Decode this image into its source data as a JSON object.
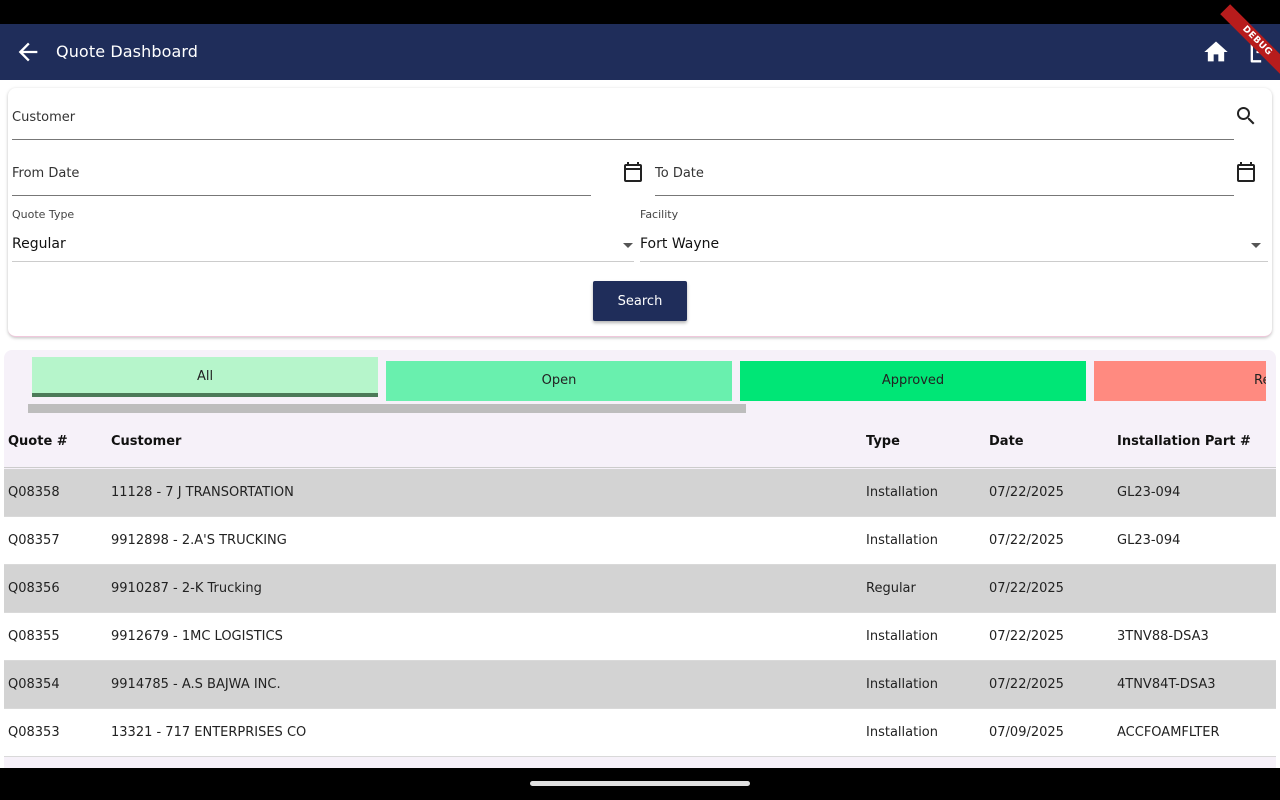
{
  "appbar": {
    "title": "Quote Dashboard",
    "debug_label": "DEBUG",
    "color": "#1f2d5a"
  },
  "filters": {
    "customer_label": "Customer",
    "from_date_label": "From Date",
    "to_date_label": "To Date",
    "quote_type_label": "Quote Type",
    "quote_type_value": "Regular",
    "facility_label": "Facility",
    "facility_value": "Fort Wayne",
    "search_label": "Search"
  },
  "tabs": [
    {
      "label": "All",
      "color": "#b6f5cb",
      "active": true
    },
    {
      "label": "Open",
      "color": "#69f0ae",
      "active": false
    },
    {
      "label": "Approved",
      "color": "#00e676",
      "active": false
    },
    {
      "label": "Rejected",
      "color": "#ff8a80",
      "active": false
    }
  ],
  "table": {
    "headers": {
      "quote": "Quote #",
      "customer": "Customer",
      "type": "Type",
      "date": "Date",
      "part": "Installation Part #"
    },
    "rows": [
      {
        "quote": "Q08358",
        "customer": "11128 - 7 J TRANSORTATION",
        "type": "Installation",
        "date": "07/22/2025",
        "part": "GL23-094"
      },
      {
        "quote": "Q08357",
        "customer": "9912898 - 2.A'S TRUCKING",
        "type": "Installation",
        "date": "07/22/2025",
        "part": "GL23-094"
      },
      {
        "quote": "Q08356",
        "customer": "9910287 - 2-K Trucking",
        "type": "Regular",
        "date": "07/22/2025",
        "part": ""
      },
      {
        "quote": "Q08355",
        "customer": "9912679 - 1MC LOGISTICS",
        "type": "Installation",
        "date": "07/22/2025",
        "part": "3TNV88-DSA3"
      },
      {
        "quote": "Q08354",
        "customer": "9914785 - A.S BAJWA INC.",
        "type": "Installation",
        "date": "07/22/2025",
        "part": "4TNV84T-DSA3"
      },
      {
        "quote": "Q08353",
        "customer": "13321 - 717 ENTERPRISES CO",
        "type": "Installation",
        "date": "07/09/2025",
        "part": "ACCFOAMFLTER"
      }
    ]
  }
}
